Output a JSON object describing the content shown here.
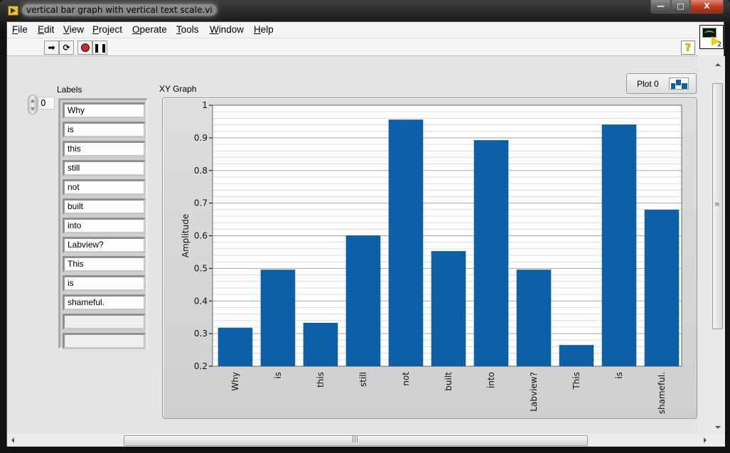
{
  "window": {
    "title": "vertical bar graph with vertical text scale.vi",
    "controls": {
      "minimize": "—",
      "maximize": "□",
      "close": "X"
    }
  },
  "menubar": {
    "items": [
      {
        "label": "File",
        "accel": "F"
      },
      {
        "label": "Edit",
        "accel": "E"
      },
      {
        "label": "View",
        "accel": "V"
      },
      {
        "label": "Project",
        "accel": "P"
      },
      {
        "label": "Operate",
        "accel": "O"
      },
      {
        "label": "Tools",
        "accel": "T"
      },
      {
        "label": "Window",
        "accel": "W"
      },
      {
        "label": "Help",
        "accel": "H"
      }
    ]
  },
  "toolbar": {
    "run_icon": "run-arrow-icon",
    "run_continuous_icon": "run-continuously-icon",
    "abort_icon": "abort-icon",
    "pause_icon": "pause-icon",
    "help_label": "?",
    "vi_icon_number": "2"
  },
  "labels_array": {
    "label": "Labels",
    "index": "0",
    "elements": [
      "Why",
      "is",
      "this",
      "still",
      "not",
      "built",
      "into",
      "Labview?",
      "This",
      "is",
      "shameful.",
      "",
      ""
    ]
  },
  "graph": {
    "label": "XY Graph",
    "legend": {
      "plot_name": "Plot 0"
    }
  },
  "colors": {
    "bar": "#0b60a8",
    "plot_bg": "#ffffff",
    "major_grid": "#a8a8a8",
    "minor_grid": "#dcdcdc"
  },
  "chart_data": {
    "type": "bar",
    "title": "XY Graph",
    "xlabel": "",
    "ylabel": "Amplitude",
    "categories": [
      "Why",
      "is",
      "this",
      "still",
      "not",
      "built",
      "into",
      "Labview?",
      "This",
      "is",
      "shameful."
    ],
    "values": [
      0.318,
      0.496,
      0.333,
      0.601,
      0.956,
      0.553,
      0.893,
      0.496,
      0.265,
      0.941,
      0.68
    ],
    "ylim": [
      0.2,
      1.0
    ],
    "yticks": [
      0.2,
      0.3,
      0.4,
      0.5,
      0.6,
      0.7,
      0.8,
      0.9,
      1.0
    ],
    "ytick_labels": [
      "0.2",
      "0.3",
      "0.4",
      "0.5",
      "0.6",
      "0.7",
      "0.8",
      "0.9",
      "1"
    ],
    "minor_ticks_per_major": 5,
    "grid": true,
    "legend": [
      "Plot 0"
    ],
    "legend_position": "top-right",
    "xtick_orientation": "vertical"
  }
}
